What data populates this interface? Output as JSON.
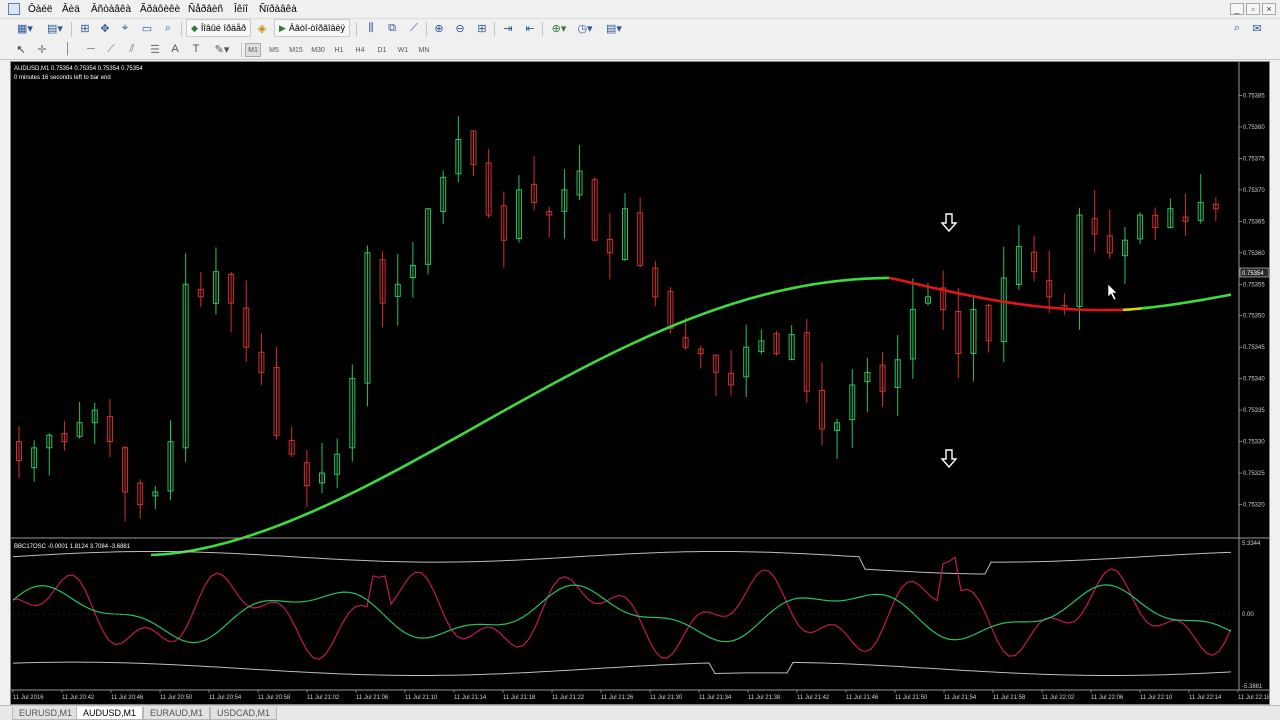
{
  "menu": {
    "items": [
      "Ôàéë",
      "Âèä",
      "Âñòàâêà",
      "Ãðàôèêè",
      "Ñåðâèñ",
      "Îêíî",
      "Ñïðàâêà"
    ],
    "window_controls": [
      "_",
      "▫",
      "×"
    ]
  },
  "toolbar": {
    "new_order_label": "Íîâûé îðäåð",
    "autotrading_label": "Àâòî-òîðãîâëÿ",
    "timeframes": [
      "M1",
      "M5",
      "M15",
      "M30",
      "H1",
      "H4",
      "D1",
      "W1",
      "MN"
    ],
    "active_timeframe": "M1"
  },
  "chart": {
    "symbol_header": "AUDUSD,M1  0.75354 0.75354 0.75354 0.75354",
    "timer_text": "0 minutes 16 seconds left to bar end",
    "current_price_label": "0.75354",
    "colors": {
      "bull": "#22c55e",
      "bear": "#d32f2f",
      "ma_up": "#3ddc3d",
      "ma_down": "#e01515",
      "ma_flat": "#d8d800",
      "background": "#000000"
    }
  },
  "oscillator": {
    "header": "BBC17OSC -0.0001 1.8124 3.7084 -3.6881",
    "axis": [
      "5.3344",
      "0.00",
      "-5.3881"
    ]
  },
  "tabs": [
    "EURUSD,M1",
    "AUDUSD,M1",
    "EURAUD,M1",
    "USDCAD,M1"
  ],
  "active_tab": "AUDUSD,M1",
  "chart_data": [
    {
      "type": "candlestick",
      "title": "AUDUSD,M1",
      "price_axis": [
        "0.75390",
        "0.75385",
        "0.75380",
        "0.75375",
        "0.75370",
        "0.75365",
        "0.75360",
        "0.75355",
        "0.75350",
        "0.75345",
        "0.75340",
        "0.75335",
        "0.75330",
        "0.75325",
        "0.75320",
        "0.75315"
      ],
      "time_axis": [
        "11 Jul 2016",
        "11 Jul 20:42",
        "11 Jul 20:46",
        "11 Jul 20:50",
        "11 Jul 20:54",
        "11 Jul 20:58",
        "11 Jul 21:02",
        "11 Jul 21:06",
        "11 Jul 21:10",
        "11 Jul 21:14",
        "11 Jul 21:18",
        "11 Jul 21:22",
        "11 Jul 21:26",
        "11 Jul 21:30",
        "11 Jul 21:34",
        "11 Jul 21:38",
        "11 Jul 21:42",
        "11 Jul 21:46",
        "11 Jul 21:50",
        "11 Jul 21:54",
        "11 Jul 21:58",
        "11 Jul 22:02",
        "11 Jul 22:06",
        "11 Jul 22:10",
        "11 Jul 22:14",
        "11 Jul 22:18"
      ],
      "ylim": [
        0.75315,
        0.7539
      ],
      "close_series": [
        0.75327,
        0.75329,
        0.75331,
        0.7533,
        0.75333,
        0.75335,
        0.7533,
        0.75322,
        0.7532,
        0.75322,
        0.7533,
        0.75355,
        0.75353,
        0.75357,
        0.75352,
        0.75345,
        0.75341,
        0.75331,
        0.75328,
        0.75323,
        0.75325,
        0.75328,
        0.7534,
        0.7536,
        0.75352,
        0.75355,
        0.75358,
        0.75367,
        0.75372,
        0.75378,
        0.75374,
        0.75366,
        0.75362,
        0.7537,
        0.75368,
        0.75366,
        0.7537,
        0.75373,
        0.75362,
        0.7536,
        0.75367,
        0.75358,
        0.75353,
        0.75348,
        0.75345,
        0.75344,
        0.75341,
        0.75339,
        0.75345,
        0.75346,
        0.75344,
        0.75347,
        0.75338,
        0.75332,
        0.75333,
        0.75339,
        0.75341,
        0.75338,
        0.75343,
        0.75351,
        0.75353,
        0.75351,
        0.75344,
        0.75351,
        0.75346,
        0.75356,
        0.75361,
        0.75357,
        0.75353,
        0.75351,
        0.75366,
        0.75363,
        0.7536,
        0.75362,
        0.75366,
        0.75364,
        0.75367,
        0.75365,
        0.75368,
        0.75367
      ],
      "moving_average": {
        "start": 0.75312,
        "peak": 0.75356,
        "end": 0.75353
      },
      "annotations": [
        "↓ arrow above bar",
        "↓ arrow below bar"
      ]
    },
    {
      "type": "line",
      "title": "BBC17OSC",
      "ylim": [
        -5.3881,
        5.3344
      ],
      "series": [
        {
          "name": "fast",
          "color": "#c2185b"
        },
        {
          "name": "slow",
          "color": "#22c55e"
        },
        {
          "name": "upper band",
          "color": "#bdbdbd"
        },
        {
          "name": "lower band",
          "color": "#bdbdbd"
        }
      ]
    }
  ]
}
